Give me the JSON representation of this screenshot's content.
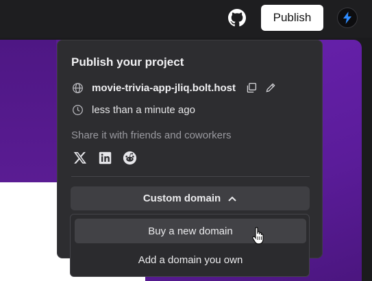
{
  "header": {
    "publish_label": "Publish"
  },
  "popover": {
    "title": "Publish your project",
    "url": "movie-trivia-app-jliq.bolt.host",
    "published_time": "less than a minute ago",
    "share_label": "Share it with friends and coworkers",
    "custom_domain_label": "Custom domain"
  },
  "dropdown": {
    "items": [
      {
        "label": "Buy a new domain"
      },
      {
        "label": "Add a domain you own"
      }
    ]
  },
  "colors": {
    "accent_purple": "#5a1c93",
    "panel": "#2d2d30",
    "bolt_blue": "#2f8cff"
  },
  "icons": {
    "header": [
      "github-icon",
      "bolt-icon"
    ],
    "popover": [
      "globe-icon",
      "copy-icon",
      "pencil-icon",
      "clock-icon",
      "x-icon",
      "linkedin-icon",
      "reddit-icon",
      "chevron-up-icon"
    ]
  }
}
